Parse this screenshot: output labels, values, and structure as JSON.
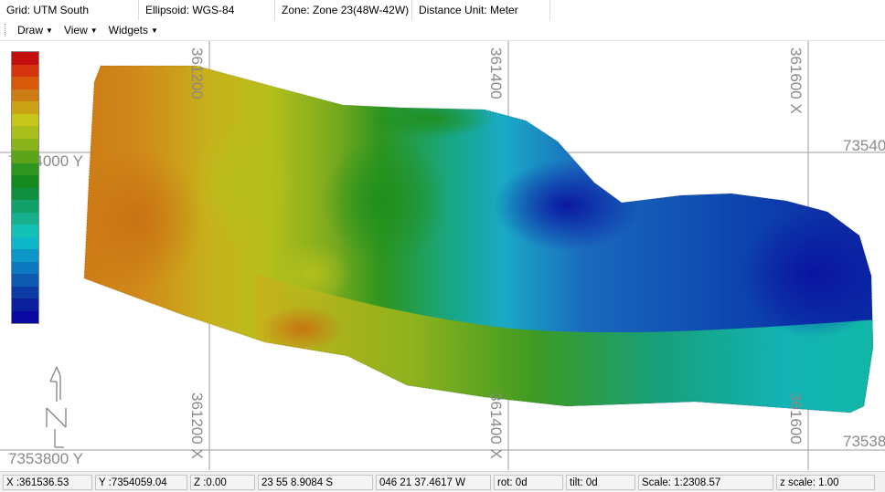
{
  "info_bar": {
    "grid": "Grid: UTM South",
    "ellipsoid": "Ellipsoid: WGS-84",
    "zone": "Zone: Zone 23(48W-42W)",
    "distance_unit": "Distance Unit: Meter"
  },
  "menu": {
    "draw": "Draw",
    "view": "View",
    "widgets": "Widgets"
  },
  "map": {
    "grid_labels": {
      "top_x1": "361200",
      "top_x2": "361400",
      "top_x3": "361600 X",
      "bottom_x1": "361200 X",
      "bottom_x2": "361400 X",
      "bottom_x3": "361600",
      "left_y1": "7354000 Y",
      "left_y2": "7353800 Y",
      "right_y1": "73540",
      "right_y2": "73538"
    },
    "north_arrow_label": "N",
    "legend_colors": [
      "#c40f0f",
      "#d4340e",
      "#d65a0a",
      "#cc7c12",
      "#c9a314",
      "#c6c51a",
      "#a9bf1c",
      "#89b21b",
      "#5ea41b",
      "#2f9521",
      "#15891e",
      "#0f9041",
      "#14a06a",
      "#17b08f",
      "#14bfb4",
      "#0fb5c8",
      "#0d97c9",
      "#0d77c0",
      "#0d5ab0",
      "#0c3ca3",
      "#0c1f9c",
      "#0a0aa0"
    ]
  },
  "status": {
    "x": "X :361536.53",
    "y": "Y :7354059.04",
    "z": "Z :0.00",
    "lat": "23 55 8.9084 S",
    "lon": "046 21 37.4617 W",
    "rot": "rot:   0d",
    "tilt": "tilt:   0d",
    "scale": "Scale: 1:2308.57",
    "z_scale": "z scale: 1.00"
  }
}
